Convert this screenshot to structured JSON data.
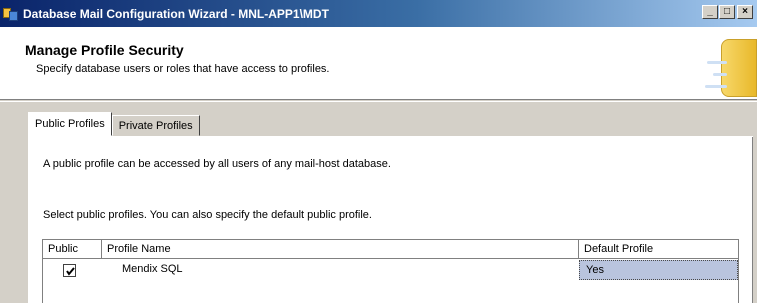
{
  "window": {
    "title": "Database Mail Configuration Wizard - MNL-APP1\\MDT",
    "controls": {
      "minimize": "_",
      "maximize": "□",
      "close": "×"
    }
  },
  "header": {
    "title": "Manage Profile Security",
    "subtitle": "Specify database users or roles that have access to profiles."
  },
  "tabs": [
    {
      "label": "Public Profiles",
      "active": true
    },
    {
      "label": "Private Profiles",
      "active": false
    }
  ],
  "panel": {
    "description": "A public profile can be accessed by all users of any mail-host database.",
    "instruction": "Select public profiles. You can also specify the default public profile."
  },
  "grid": {
    "columns": [
      "Public",
      "Profile Name",
      "Default Profile"
    ],
    "rows": [
      {
        "public": true,
        "profile_name": "Mendix SQL",
        "default_profile": "Yes"
      }
    ]
  },
  "icons": {
    "app": "database-mail-icon",
    "header_graphic": "database-wizard-graphic",
    "checkbox": "checkmark-icon"
  },
  "colors": {
    "titlebar_start": "#0a246a",
    "titlebar_end": "#a6caf0",
    "selected_cell": "#b9c4de",
    "window_bg": "#d4d0c8"
  }
}
